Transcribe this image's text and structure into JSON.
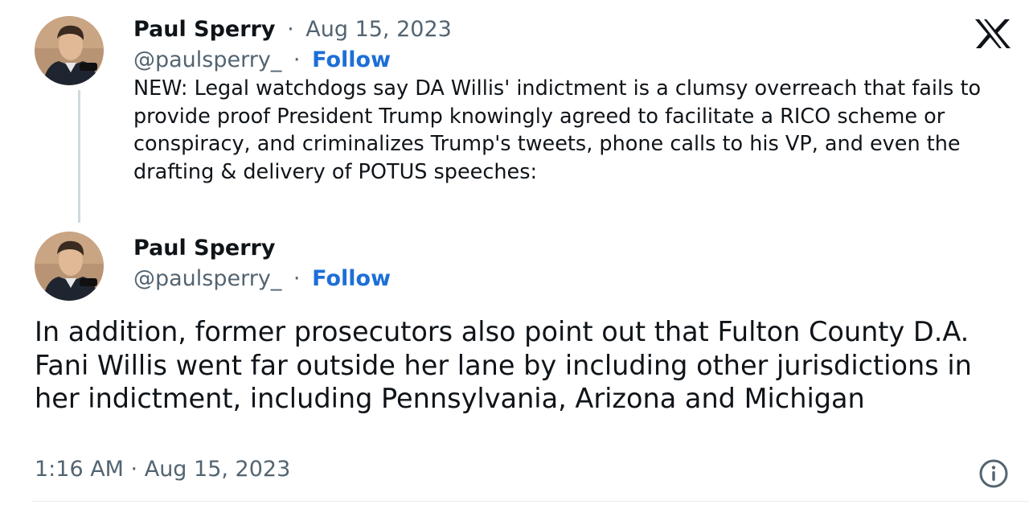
{
  "main_tweet": {
    "author_name": "Paul Sperry",
    "separator": "·",
    "date": "Aug 15, 2023",
    "handle": "@paulsperry_",
    "follow_label": "Follow",
    "text": "NEW: Legal watchdogs say DA Willis' indictment is a clumsy overreach that fails to provide proof President Trump knowingly agreed to facilitate a RICO scheme or conspiracy, and criminalizes Trump's tweets, phone calls to his VP, and even the drafting & delivery of POTUS speeches:"
  },
  "reply_tweet": {
    "author_name": "Paul Sperry",
    "handle": "@paulsperry_",
    "separator": "·",
    "follow_label": "Follow",
    "text": "In addition, former prosecutors also point out that Fulton County D.A. Fani Willis went far outside her lane by including other jurisdictions in her indictment, including Pennsylvania, Arizona and Michigan",
    "timestamp": "1:16 AM · Aug 15, 2023"
  },
  "icons": {
    "brand": "x-logo-icon",
    "info": "info-icon"
  },
  "colors": {
    "follow": "#1d6fd8",
    "muted": "#536471",
    "text": "#0f1419",
    "thread_line": "#cfd9de"
  }
}
